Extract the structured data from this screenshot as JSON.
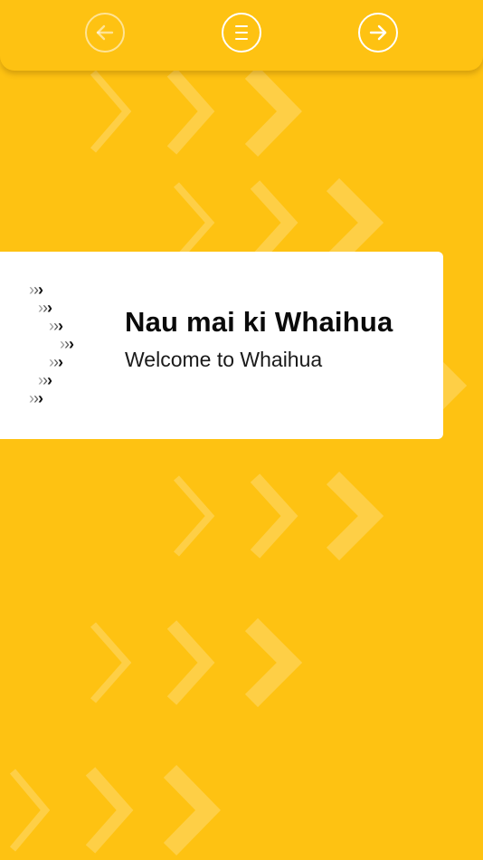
{
  "nav": {
    "back_icon": "arrow-left-icon",
    "menu_icon": "menu-icon",
    "next_icon": "arrow-right-icon",
    "back_enabled": false
  },
  "welcome": {
    "title": "Nau mai ki Whaihua",
    "subtitle": "Welcome to Whaihua"
  },
  "colors": {
    "background": "#FEC212",
    "card": "#FFFFFF",
    "text": "#0A0A0A",
    "icon": "#FFFFFF"
  }
}
